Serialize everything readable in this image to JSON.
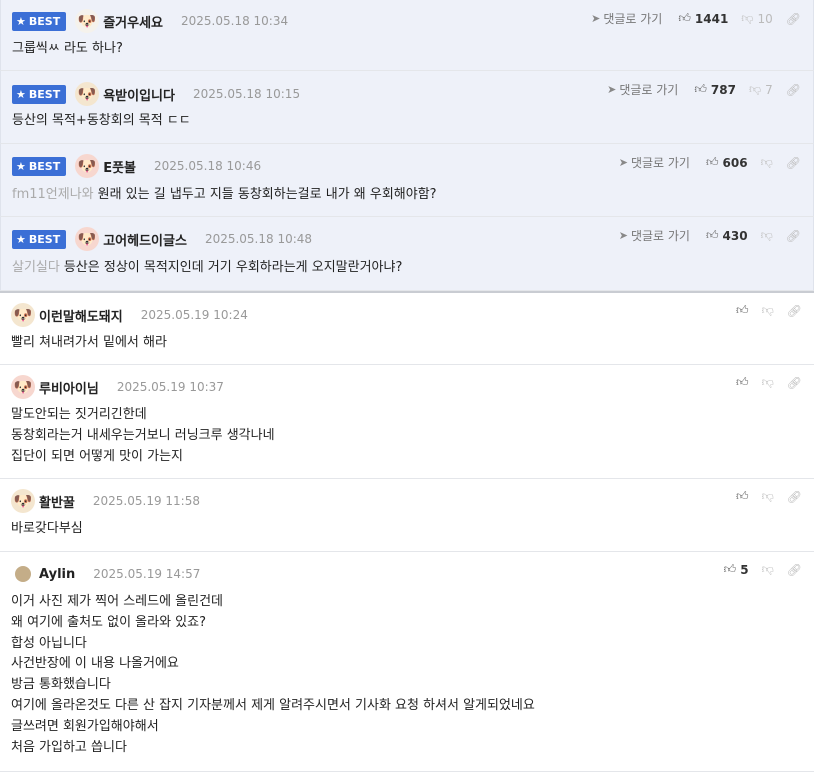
{
  "ui": {
    "reply_label": "댓글로 가기",
    "best_label": "BEST"
  },
  "comments": [
    {
      "best": true,
      "nick": "즐거우세요",
      "date": "2025.05.18 10:34",
      "up": "1441",
      "down": "10",
      "mention": "",
      "lines": [
        "그룹씩ㅆ 라도 하나?"
      ]
    },
    {
      "best": true,
      "nick": "욕받이입니다",
      "date": "2025.05.18 10:15",
      "up": "787",
      "down": "7",
      "mention": "",
      "lines": [
        "등산의 목적+동창회의 목적 ㄷㄷ"
      ]
    },
    {
      "best": true,
      "nick": "E풋볼",
      "date": "2025.05.18 10:46",
      "up": "606",
      "down": "",
      "mention": "fm11언제나와",
      "lines": [
        "원래 있는 길 냅두고 지들 동창회하는걸로 내가 왜 우회해야함?"
      ]
    },
    {
      "best": true,
      "nick": "고어헤드이글스",
      "date": "2025.05.18 10:48",
      "up": "430",
      "down": "",
      "mention": "살기실다",
      "lines": [
        "등산은 정상이 목적지인데 거기 우회하라는게 오지말란거아냐?"
      ]
    },
    {
      "best": false,
      "nick": "이런말해도돼지",
      "date": "2025.05.19 10:24",
      "up": "",
      "down": "",
      "mention": "",
      "lines": [
        "빨리 쳐내려가서 밑에서 해라"
      ]
    },
    {
      "best": false,
      "nick": "루비아이님",
      "date": "2025.05.19 10:37",
      "up": "",
      "down": "",
      "mention": "",
      "lines": [
        "말도안되는 짓거리긴한데",
        "동창회라는거 내세우는거보니 러닝크루 생각나네",
        "집단이 되면 어떻게 맛이 가는지"
      ]
    },
    {
      "best": false,
      "nick": "활반꿀",
      "date": "2025.05.19 11:58",
      "up": "",
      "down": "",
      "mention": "",
      "lines": [
        "바로갖다부심"
      ]
    },
    {
      "best": false,
      "nick": "Aylin",
      "date": "2025.05.19 14:57",
      "up": "5",
      "down": "",
      "mention": "",
      "lines": [
        "이거 사진 제가 찍어 스레드에 올린건데",
        "왜 여기에 출처도 없이 올라와 있죠?",
        "합성 아닙니다",
        "사건반장에 이 내용 나올거에요",
        "방금 통화했습니다",
        "여기에 올라온것도 다른 산 잡지 기자분께서 제게 알려주시면서 기사화 요청 하셔서 알게되었네요",
        "글쓰려면 회원가입해야해서",
        "처음 가입하고 씁니다"
      ]
    }
  ]
}
